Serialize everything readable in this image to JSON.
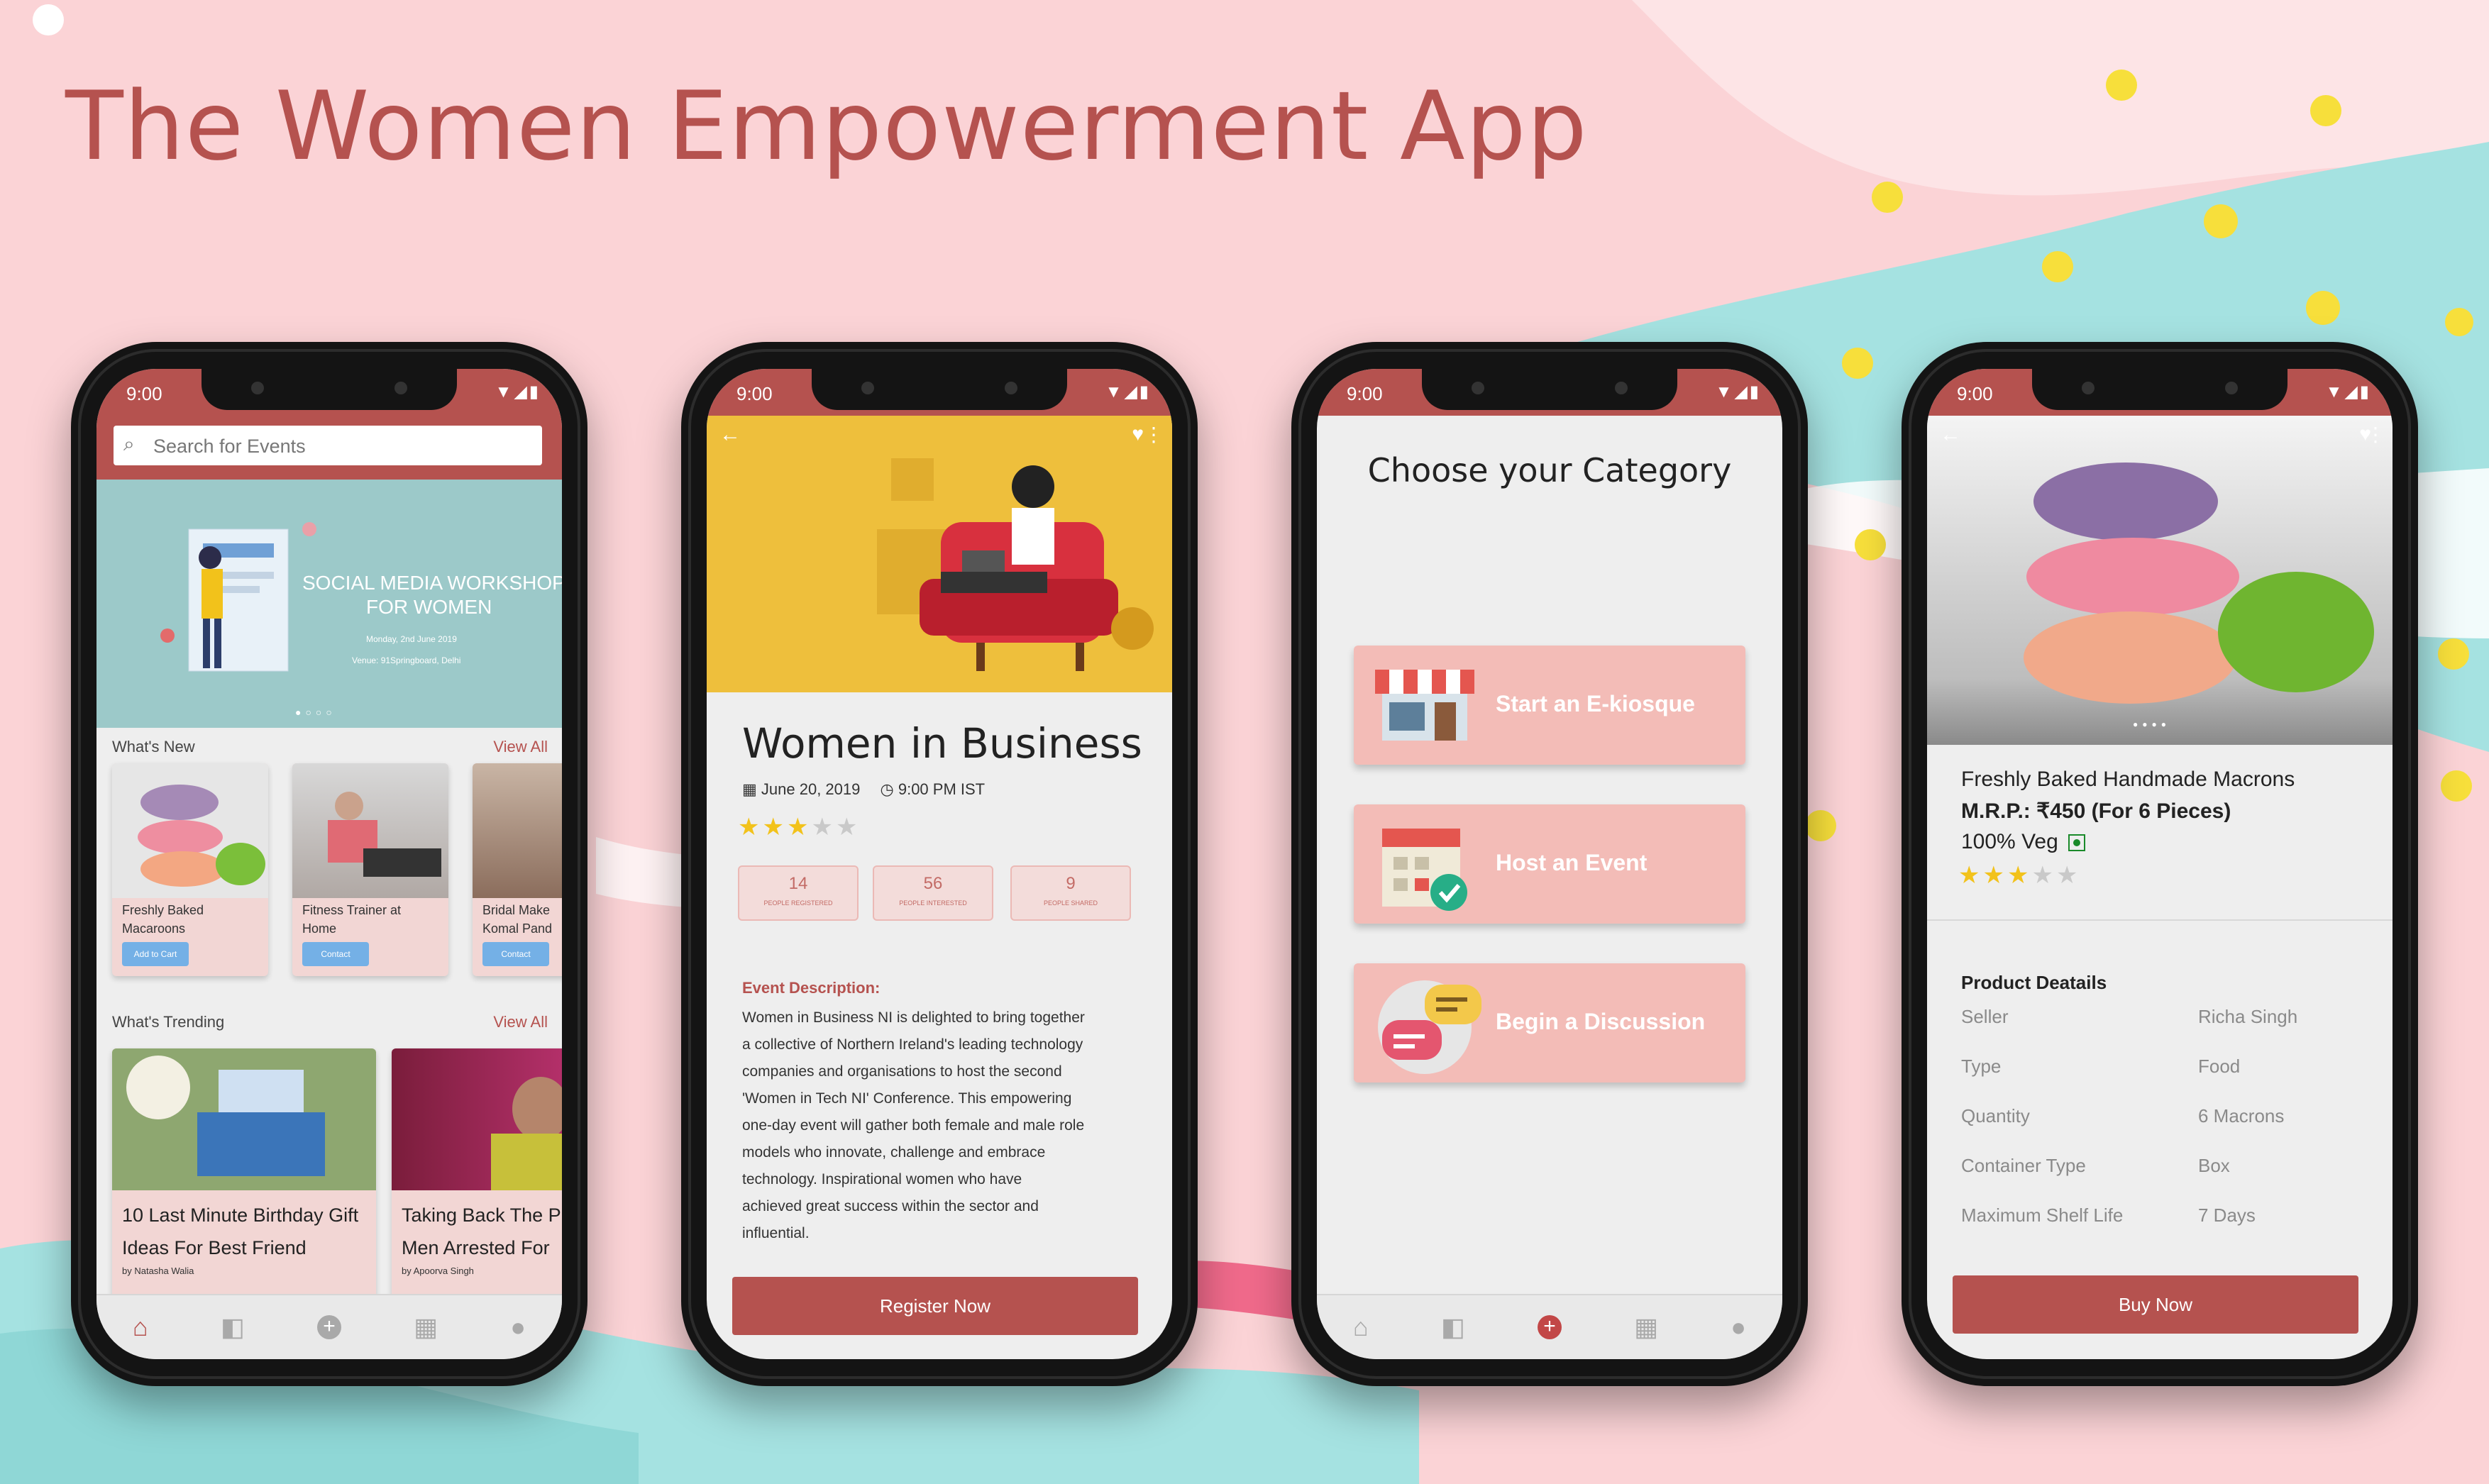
{
  "app_title": "The Women Empowerment App",
  "status": {
    "time": "9:00"
  },
  "phone1": {
    "search_placeholder": "Search for Events",
    "banner": {
      "title_line1": "SOCIAL MEDIA WORKSHOP",
      "title_line2": "FOR WOMEN",
      "date": "Monday, 2nd June 2019",
      "venue": "Venue: 91Springboard, Delhi"
    },
    "whats_new": {
      "title": "What's New",
      "view_all": "View All",
      "items": [
        {
          "title_line1": "Freshly Baked",
          "title_line2": "Macaroons",
          "button": "Add to Cart"
        },
        {
          "title_line1": "Fitness Trainer at",
          "title_line2": "Home",
          "button": "Contact"
        },
        {
          "title_line1": "Bridal Make",
          "title_line2": "Komal Pand",
          "button": "Contact"
        }
      ]
    },
    "whats_trending": {
      "title": "What's Trending",
      "view_all": "View All",
      "items": [
        {
          "line1": "10 Last Minute Birthday Gift",
          "line2": "Ideas For Best Friend",
          "author": "by Natasha Walia"
        },
        {
          "line1": "Taking Back The P",
          "line2": "Men Arrested For",
          "author": "by Apoorva Singh"
        }
      ]
    }
  },
  "phone2": {
    "event_title": "Women in Business",
    "date": "June 20, 2019",
    "time": "9:00 PM IST",
    "rating": 3,
    "rating_max": 5,
    "stats": [
      {
        "value": "14",
        "label": "PEOPLE REGISTERED"
      },
      {
        "value": "56",
        "label": "PEOPLE INTERESTED"
      },
      {
        "value": "9",
        "label": "PEOPLE SHARED"
      }
    ],
    "desc_label": "Event Description:",
    "desc_lines": [
      "Women in Business NI is delighted to bring together",
      "a collective of Northern Ireland's leading technology",
      "companies and organisations to host the second",
      "'Women in Tech NI' Conference.  This empowering",
      "one-day event will gather both female and male role",
      "models who innovate, challenge and embrace",
      "technology.  Inspirational women who have",
      "achieved great success within the sector and",
      "influential."
    ],
    "register_button": "Register Now"
  },
  "phone3": {
    "heading": "Choose your Category",
    "categories": [
      "Start an E-kiosque",
      "Host an Event",
      "Begin a Discussion"
    ]
  },
  "phone4": {
    "product_name": "Freshly Baked Handmade Macrons",
    "price": "M.R.P.: ₹450 (For 6 Pieces)",
    "veg": "100% Veg",
    "rating": 3,
    "rating_max": 5,
    "details_title": "Product Deatails",
    "details": [
      {
        "key": "Seller",
        "value": "Richa Singh"
      },
      {
        "key": "Type",
        "value": "Food"
      },
      {
        "key": "Quantity",
        "value": "6 Macrons"
      },
      {
        "key": "Container Type",
        "value": "Box"
      },
      {
        "key": "Maximum Shelf Life",
        "value": "7 Days"
      }
    ],
    "buy_button": "Buy Now"
  },
  "colors": {
    "brand": "#b5524f",
    "pink_bg": "#fbd3d6",
    "teal": "#a5e2e1",
    "yellow": "#f7df3b",
    "card_pink": "#f3bcb7"
  }
}
